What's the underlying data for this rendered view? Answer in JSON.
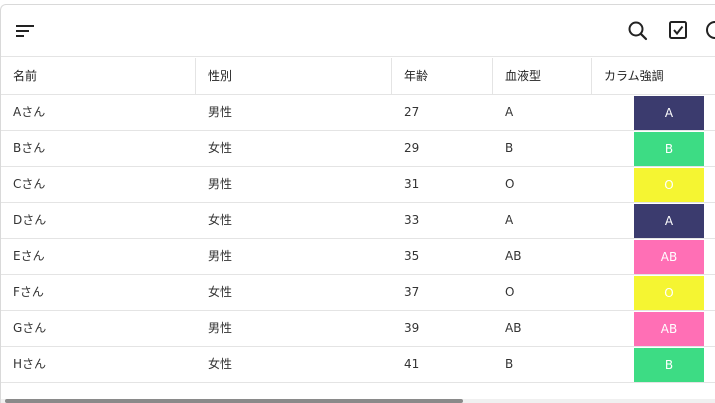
{
  "toolbar": {
    "sort_icon": "sort-lines-icon",
    "search_icon": "search-icon",
    "checkbox_icon": "checkbox-icon",
    "more_icon": "circle-icon"
  },
  "table": {
    "columns": [
      "名前",
      "性別",
      "年齢",
      "血液型",
      "カラム強調"
    ],
    "rows": [
      {
        "name": "Aさん",
        "gender": "男性",
        "age": "27",
        "blood": "A",
        "highlight": "A"
      },
      {
        "name": "Bさん",
        "gender": "女性",
        "age": "29",
        "blood": "B",
        "highlight": "B"
      },
      {
        "name": "Cさん",
        "gender": "男性",
        "age": "31",
        "blood": "O",
        "highlight": "O"
      },
      {
        "name": "Dさん",
        "gender": "女性",
        "age": "33",
        "blood": "A",
        "highlight": "A"
      },
      {
        "name": "Eさん",
        "gender": "男性",
        "age": "35",
        "blood": "AB",
        "highlight": "AB"
      },
      {
        "name": "Fさん",
        "gender": "女性",
        "age": "37",
        "blood": "O",
        "highlight": "O"
      },
      {
        "name": "Gさん",
        "gender": "男性",
        "age": "39",
        "blood": "AB",
        "highlight": "AB"
      },
      {
        "name": "Hさん",
        "gender": "女性",
        "age": "41",
        "blood": "B",
        "highlight": "B"
      }
    ]
  },
  "colors": {
    "A": {
      "bg": "#3b3b6e",
      "fg": "#ffffff"
    },
    "B": {
      "bg": "#3ddc84",
      "fg": "#ffffff"
    },
    "O": {
      "bg": "#f5f532",
      "fg": "#ffffff"
    },
    "AB": {
      "bg": "#ff6fb5",
      "fg": "#ffffff"
    }
  }
}
